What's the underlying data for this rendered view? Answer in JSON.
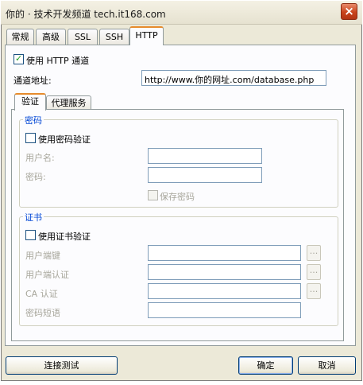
{
  "window": {
    "title": "你的 · 技术开发频道 tech.it168.com",
    "close_glyph": "×"
  },
  "tabs": [
    "常规",
    "高级",
    "SSL",
    "SSH",
    "HTTP"
  ],
  "active_tab": "HTTP",
  "http_tunnel": {
    "use_label": "使用 HTTP 通道",
    "checked": true,
    "address_label": "通道地址:",
    "address_value": "http://www.你的网址.com/database.php"
  },
  "subtabs": [
    "验证",
    "代理服务"
  ],
  "active_subtab": "验证",
  "password_group": {
    "title": "密码",
    "use_label": "使用密码验证",
    "checked": false,
    "username_label": "用户名:",
    "password_label": "密码:",
    "save_password_label": "保存密码"
  },
  "cert_group": {
    "title": "证书",
    "use_label": "使用证书验证",
    "checked": false,
    "client_key_label": "用户端键",
    "client_cert_label": "用户端认证",
    "ca_cert_label": "CA 认证",
    "passphrase_label": "密码短语",
    "browse_glyph": "..."
  },
  "buttons": {
    "test": "连接测试",
    "ok": "确定",
    "cancel": "取消"
  },
  "colors": {
    "tab_accent": "#e68b2c",
    "group_title": "#0046d5",
    "check_mark": "#21a121",
    "close_button": "#c9441c"
  }
}
